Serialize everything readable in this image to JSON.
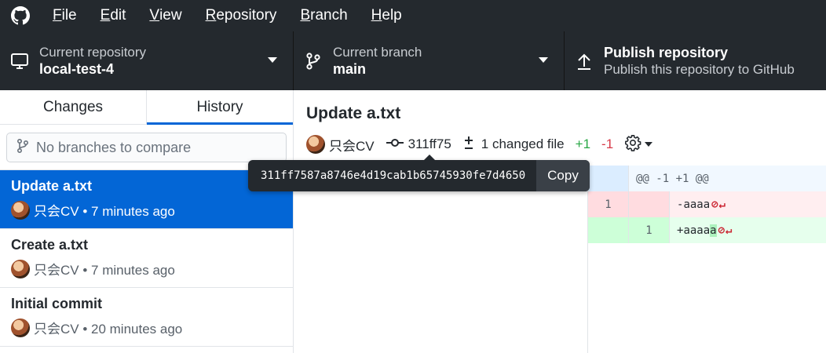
{
  "menu": {
    "items": [
      {
        "label": "File",
        "u": "F",
        "rest": "ile"
      },
      {
        "label": "Edit",
        "u": "E",
        "rest": "dit"
      },
      {
        "label": "View",
        "u": "V",
        "rest": "iew"
      },
      {
        "label": "Repository",
        "u": "R",
        "rest": "epository"
      },
      {
        "label": "Branch",
        "u": "B",
        "rest": "ranch"
      },
      {
        "label": "Help",
        "u": "H",
        "rest": "elp"
      }
    ]
  },
  "toolbar": {
    "repo_label": "Current repository",
    "repo_value": "local-test-4",
    "branch_label": "Current branch",
    "branch_value": "main",
    "publish_title": "Publish repository",
    "publish_desc": "Publish this repository to GitHub"
  },
  "sidebar": {
    "tabs": [
      "Changes",
      "History"
    ],
    "compare_placeholder": "No branches to compare",
    "commits": [
      {
        "title": "Update a.txt",
        "meta": "只会CV • 7 minutes ago"
      },
      {
        "title": "Create a.txt",
        "meta": "只会CV • 7 minutes ago"
      },
      {
        "title": "Initial commit",
        "meta": "只会CV • 20 minutes ago"
      }
    ]
  },
  "main": {
    "title": "Update a.txt",
    "author": "只会CV",
    "sha_short": "311ff75",
    "changed_files": "1 changed file",
    "additions": "+1",
    "deletions": "-1"
  },
  "diff": {
    "hunk_header": "@@ -1 +1 @@",
    "rows": [
      {
        "type": "del",
        "old": "1",
        "new": "",
        "prefix": "-",
        "text": "aaaa",
        "highlight": ""
      },
      {
        "type": "add",
        "old": "",
        "new": "1",
        "prefix": "+",
        "text": "aaaa",
        "highlight": "a"
      }
    ]
  },
  "tooltip": {
    "sha_full": "311ff7587a8746e4d19cab1b65745930fe7d4650",
    "copy_label": "Copy"
  },
  "colors": {
    "accent": "#0366d6",
    "chrome": "#24292e",
    "additions": "#28a745",
    "deletions": "#d73a49"
  }
}
